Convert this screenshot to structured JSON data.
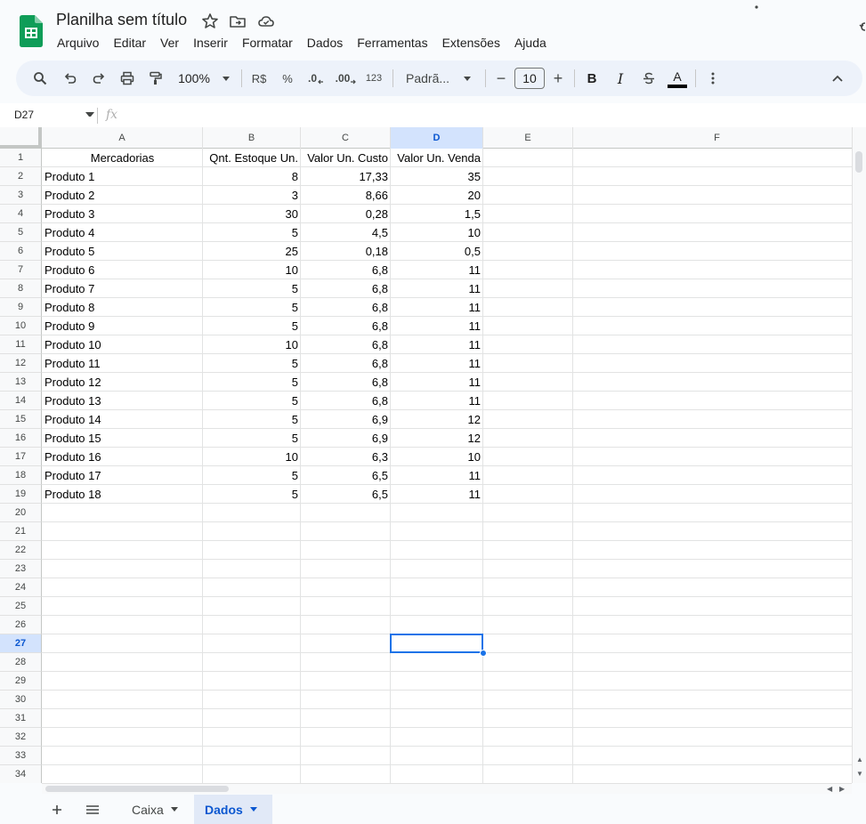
{
  "app": {
    "doc_title": "Planilha sem título",
    "menu": [
      "Arquivo",
      "Editar",
      "Ver",
      "Inserir",
      "Formatar",
      "Dados",
      "Ferramentas",
      "Extensões",
      "Ajuda"
    ]
  },
  "toolbar": {
    "zoom": "100%",
    "currency": "R$",
    "percent": "%",
    "decimal_decrease": ".0",
    "decimal_increase": ".00",
    "number_format": "123",
    "font_name": "Padrã...",
    "font_size": "10",
    "minus": "−",
    "plus": "+",
    "bold": "B",
    "italic": "I",
    "text_color_letter": "A",
    "colors": {
      "accent": "#0b57d0",
      "toolbar_bg": "#edf2fa",
      "selection": "#1a73e8",
      "logo": "#0f9d58"
    }
  },
  "formula_bar": {
    "name_box": "D27",
    "fx": "fx",
    "formula": ""
  },
  "grid": {
    "columns": [
      "A",
      "B",
      "C",
      "D",
      "E",
      "F"
    ],
    "selected_column": "D",
    "selected_row": "27",
    "row_numbers": [
      "1",
      "2",
      "3",
      "4",
      "5",
      "6",
      "7",
      "8",
      "9",
      "10",
      "11",
      "12",
      "13",
      "14",
      "15",
      "16",
      "17",
      "18",
      "19",
      "20",
      "21",
      "22",
      "23",
      "24",
      "25",
      "26",
      "27",
      "28",
      "29",
      "30",
      "31",
      "32",
      "33",
      "34"
    ],
    "header_row": [
      "Mercadorias",
      "Qnt. Estoque Un.",
      "Valor Un. Custo",
      "Valor Un. Venda"
    ],
    "rows": [
      [
        "Produto 1",
        "8",
        "17,33",
        "35"
      ],
      [
        "Produto 2",
        "3",
        "8,66",
        "20"
      ],
      [
        "Produto 3",
        "30",
        "0,28",
        "1,5"
      ],
      [
        "Produto 4",
        "5",
        "4,5",
        "10"
      ],
      [
        "Produto 5",
        "25",
        "0,18",
        "0,5"
      ],
      [
        "Produto 6",
        "10",
        "6,8",
        "11"
      ],
      [
        "Produto 7",
        "5",
        "6,8",
        "11"
      ],
      [
        "Produto 8",
        "5",
        "6,8",
        "11"
      ],
      [
        "Produto 9",
        "5",
        "6,8",
        "11"
      ],
      [
        "Produto 10",
        "10",
        "6,8",
        "11"
      ],
      [
        "Produto 11",
        "5",
        "6,8",
        "11"
      ],
      [
        "Produto 12",
        "5",
        "6,8",
        "11"
      ],
      [
        "Produto 13",
        "5",
        "6,8",
        "11"
      ],
      [
        "Produto 14",
        "5",
        "6,9",
        "12"
      ],
      [
        "Produto 15",
        "5",
        "6,9",
        "12"
      ],
      [
        "Produto 16",
        "10",
        "6,3",
        "10"
      ],
      [
        "Produto 17",
        "5",
        "6,5",
        "11"
      ],
      [
        "Produto 18",
        "5",
        "6,5",
        "11"
      ]
    ]
  },
  "tabs": {
    "sheets": [
      "Caixa",
      "Dados"
    ],
    "active": "Dados"
  }
}
